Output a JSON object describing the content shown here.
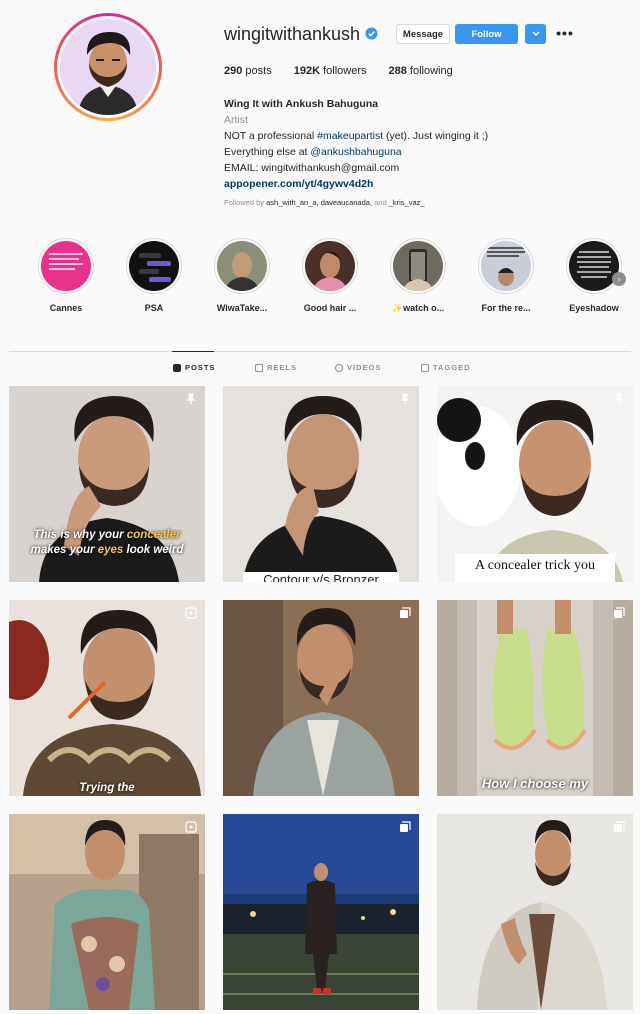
{
  "profile": {
    "username": "wingitwithankush",
    "verified": true,
    "message_label": "Message",
    "follow_label": "Follow",
    "more_label": "•••",
    "stats": {
      "posts_count": "290",
      "posts_label": "posts",
      "followers_count": "192K",
      "followers_label": "followers",
      "following_count": "288",
      "following_label": "following"
    },
    "bio": {
      "name": "Wing It with Ankush Bahuguna",
      "category": "Artist",
      "line1_pre": "NOT a professional ",
      "line1_tag": "#makeupartist",
      "line1_post": " (yet). Just winging it ;)",
      "line2_pre": "Everything else at ",
      "line2_tag": "@ankushbahuguna",
      "line3": "EMAIL: wingitwithankush@gmail.com",
      "link": "appopener.com/yt/4gywv4d2h"
    },
    "followed_by": {
      "prefix": "Followed by ",
      "users": "ash_with_an_a, daveaucanada,",
      "and": " and ",
      "last": "_kris_vaz_"
    }
  },
  "highlights": [
    {
      "label": "Cannes"
    },
    {
      "label": "PSA"
    },
    {
      "label": "WiwaTake..."
    },
    {
      "label": "Good hair ..."
    },
    {
      "label": "✨watch o..."
    },
    {
      "label": "For the re..."
    },
    {
      "label": "Eyeshadow"
    }
  ],
  "tabs": [
    {
      "label": "POSTS",
      "active": true
    },
    {
      "label": "REELS",
      "active": false
    },
    {
      "label": "VIDEOS",
      "active": false
    },
    {
      "label": "TAGGED",
      "active": false
    }
  ],
  "posts": [
    {
      "caption_a": "This is why your ",
      "caption_b": "concealer",
      "caption_c": "makes your ",
      "caption_d": "eyes",
      "caption_e": " look weird",
      "badge": "pin-icon"
    },
    {
      "caption": "Contour v/s Bronzer",
      "badge": "pin-icon"
    },
    {
      "caption": "A concealer trick you",
      "badge": "pin-icon"
    },
    {
      "caption": "Trying the",
      "badge": "reel-icon"
    },
    {
      "caption": "",
      "badge": "carousel-icon"
    },
    {
      "caption": "How I choose my",
      "badge": "carousel-icon"
    },
    {
      "caption": "",
      "badge": "reel-icon"
    },
    {
      "caption": "",
      "badge": "carousel-icon"
    },
    {
      "caption": "",
      "badge": "carousel-icon"
    }
  ],
  "colors": {
    "accent": "#3897f0",
    "link": "#00376b",
    "caption_yellow": "#f7c843"
  }
}
